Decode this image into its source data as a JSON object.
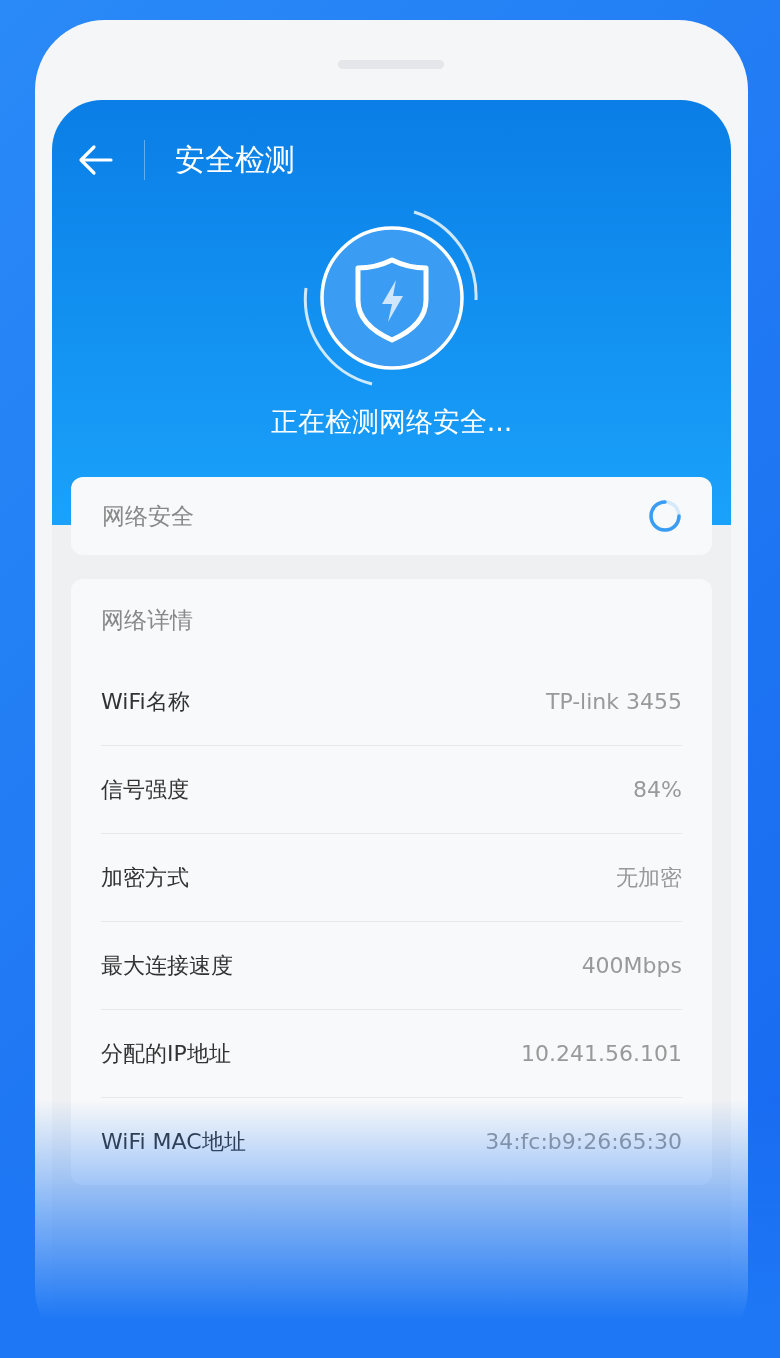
{
  "header": {
    "title": "安全检测",
    "status": "正在检测网络安全..."
  },
  "security_card": {
    "label": "网络安全",
    "checking": true
  },
  "details": {
    "title": "网络详情",
    "rows": [
      {
        "label": "WiFi名称",
        "value": "TP-link 3455"
      },
      {
        "label": "信号强度",
        "value": "84%"
      },
      {
        "label": "加密方式",
        "value": "无加密"
      },
      {
        "label": "最大连接速度",
        "value": "400Mbps"
      },
      {
        "label": "分配的IP地址",
        "value": "10.241.56.101"
      },
      {
        "label": "WiFi MAC地址",
        "value": "34:fc:b9:26:65:30"
      }
    ]
  }
}
